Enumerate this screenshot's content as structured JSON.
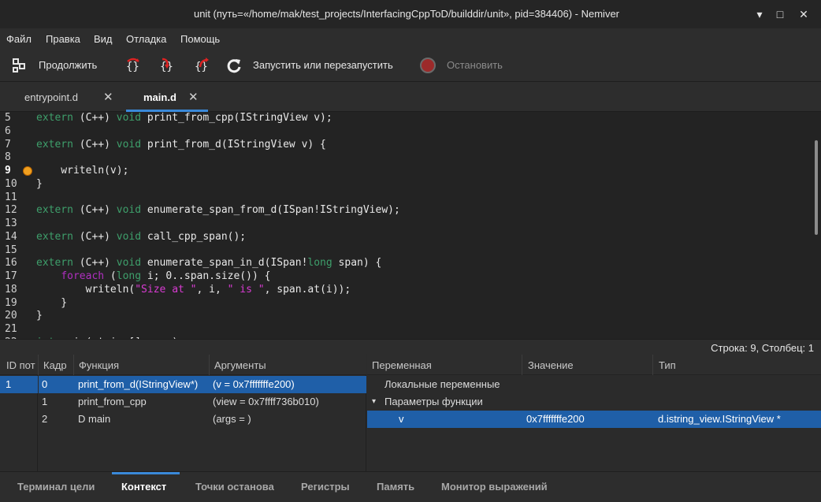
{
  "window": {
    "title": "unit (путь=«/home/mak/test_projects/InterfacingCppToD/builddir/unit», pid=384406) - Nemiver",
    "minimize": "▾",
    "maximize": "□",
    "close": "✕"
  },
  "menu": [
    "Файл",
    "Правка",
    "Вид",
    "Отладка",
    "Помощь"
  ],
  "toolbar": {
    "continue_label": "Продолжить",
    "restart_label": "Запустить или перезапустить",
    "stop_label": "Остановить"
  },
  "file_tabs": [
    {
      "label": "entrypoint.d",
      "close": "✕",
      "active": false
    },
    {
      "label": "main.d",
      "close": "✕",
      "active": true
    }
  ],
  "editor": {
    "current_line": 9,
    "lines": [
      {
        "num": "5",
        "code": [
          [
            "kw",
            "extern"
          ],
          [
            "t",
            " (C++) "
          ],
          [
            "kw",
            "void"
          ],
          [
            "t",
            " print_from_cpp(IStringView v);"
          ]
        ]
      },
      {
        "num": "6",
        "code": []
      },
      {
        "num": "7",
        "code": [
          [
            "kw",
            "extern"
          ],
          [
            "t",
            " (C++) "
          ],
          [
            "kw",
            "void"
          ],
          [
            "t",
            " print_from_d(IStringView v) {"
          ]
        ]
      },
      {
        "num": "8",
        "code": []
      },
      {
        "num": "9",
        "code": [
          [
            "t",
            "    writeln(v);"
          ]
        ]
      },
      {
        "num": "10",
        "code": [
          [
            "t",
            "}"
          ]
        ]
      },
      {
        "num": "11",
        "code": []
      },
      {
        "num": "12",
        "code": [
          [
            "kw",
            "extern"
          ],
          [
            "t",
            " (C++) "
          ],
          [
            "kw",
            "void"
          ],
          [
            "t",
            " enumerate_span_from_d(ISpan!IStringView);"
          ]
        ]
      },
      {
        "num": "13",
        "code": []
      },
      {
        "num": "14",
        "code": [
          [
            "kw",
            "extern"
          ],
          [
            "t",
            " (C++) "
          ],
          [
            "kw",
            "void"
          ],
          [
            "t",
            " call_cpp_span();"
          ]
        ]
      },
      {
        "num": "15",
        "code": []
      },
      {
        "num": "16",
        "code": [
          [
            "kw",
            "extern"
          ],
          [
            "t",
            " (C++) "
          ],
          [
            "kw",
            "void"
          ],
          [
            "t",
            " enumerate_span_in_d(ISpan!"
          ],
          [
            "kw",
            "long"
          ],
          [
            "t",
            " span) {"
          ]
        ]
      },
      {
        "num": "17",
        "code": [
          [
            "t",
            "    "
          ],
          [
            "kw2",
            "foreach"
          ],
          [
            "t",
            " ("
          ],
          [
            "kw",
            "long"
          ],
          [
            "t",
            " i; 0..span.size()) {"
          ]
        ]
      },
      {
        "num": "18",
        "code": [
          [
            "t",
            "        writeln("
          ],
          [
            "str",
            "\"Size at \""
          ],
          [
            "t",
            ", i, "
          ],
          [
            "str",
            "\" is \""
          ],
          [
            "t",
            ", span.at(i));"
          ]
        ]
      },
      {
        "num": "19",
        "code": [
          [
            "t",
            "    }"
          ]
        ]
      },
      {
        "num": "20",
        "code": [
          [
            "t",
            "}"
          ]
        ]
      },
      {
        "num": "21",
        "code": []
      },
      {
        "num": "22",
        "code": [
          [
            "kw",
            "int"
          ],
          [
            "t",
            " main(string[] args)"
          ]
        ]
      }
    ]
  },
  "status": {
    "position": "Строка: 9, Столбец: 1"
  },
  "callstack": {
    "headers": [
      "ID пот",
      "Кадр",
      "Функция",
      "Аргументы"
    ],
    "thread_id": "1",
    "frames": [
      {
        "frame": "0",
        "function": "print_from_d(IStringView*)",
        "args": "(v = 0x7fffffffe200)",
        "selected": true
      },
      {
        "frame": "1",
        "function": "print_from_cpp",
        "args": "(view = 0x7ffff736b010)",
        "selected": false
      },
      {
        "frame": "2",
        "function": "D main",
        "args": "(args = )",
        "selected": false
      }
    ]
  },
  "variables": {
    "headers": [
      "Переменная",
      "Значение",
      "Тип"
    ],
    "local_label": "Локальные переменные",
    "params_label": "Параметры функции",
    "expander": "▾",
    "param": {
      "name": "v",
      "value": "0x7fffffffe200",
      "type": "d.istring_view.IStringView *"
    }
  },
  "bottom_tabs": [
    "Терминал цели",
    "Контекст",
    "Точки останова",
    "Регистры",
    "Память",
    "Монитор выражений"
  ],
  "active_bottom_tab": 1,
  "colors": {
    "accent": "#3a89d9",
    "selection": "#1f5fa8",
    "keyword": "#3e9f6b",
    "string": "#d83bd2"
  }
}
